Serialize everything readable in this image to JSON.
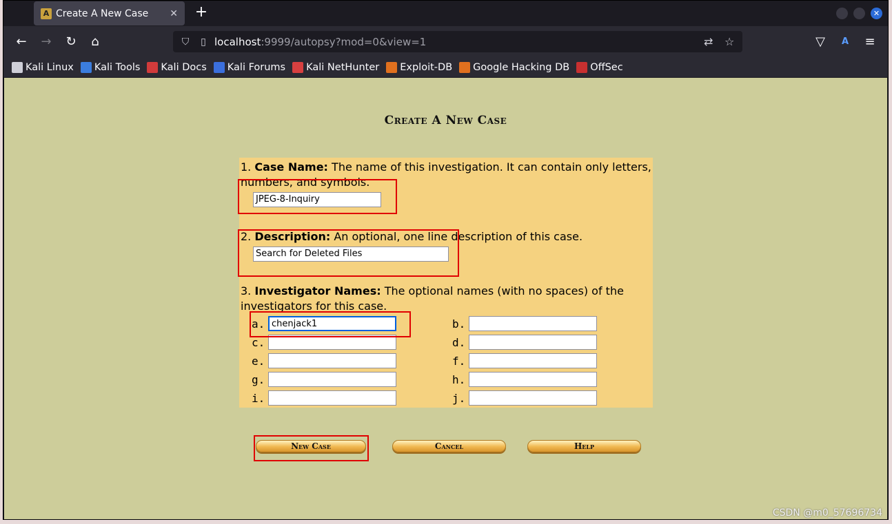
{
  "browser": {
    "tab_title": "Create A New Case",
    "tab_close": "✕",
    "new_tab": "+",
    "url_host": "localhost",
    "url_path": ":9999/autopsy?mod=0&view=1",
    "bookmarks": [
      {
        "label": "Kali Linux",
        "icon": "kali-dragon-icon",
        "color": "#cfcfd8"
      },
      {
        "label": "Kali Tools",
        "icon": "kali-tools-icon",
        "color": "#3b7ddd"
      },
      {
        "label": "Kali Docs",
        "icon": "kali-docs-icon",
        "color": "#d13b3b"
      },
      {
        "label": "Kali Forums",
        "icon": "kali-forums-icon",
        "color": "#3b6fdd"
      },
      {
        "label": "Kali NetHunter",
        "icon": "kali-nethunter-icon",
        "color": "#d84040"
      },
      {
        "label": "Exploit-DB",
        "icon": "exploit-db-icon",
        "color": "#e0701e"
      },
      {
        "label": "Google Hacking DB",
        "icon": "ghdb-icon",
        "color": "#e0701e"
      },
      {
        "label": "OffSec",
        "icon": "offsec-icon",
        "color": "#c83030"
      }
    ]
  },
  "page": {
    "title": "Create A New Case",
    "case_name": {
      "number": "1.",
      "label": "Case Name:",
      "help": " The name of this investigation. It can contain only letters, numbers, and symbols.",
      "value": "JPEG-8-Inquiry"
    },
    "description": {
      "number": "2.",
      "label": "Description:",
      "help": " An optional, one line description of this case.",
      "value": "Search for Deleted Files"
    },
    "investigators": {
      "number": "3.",
      "label": "Investigator Names:",
      "help": " The optional names (with no spaces) of the investigators for this case.",
      "fields": [
        {
          "letter": "a.",
          "value": "chenjack1"
        },
        {
          "letter": "b.",
          "value": ""
        },
        {
          "letter": "c.",
          "value": ""
        },
        {
          "letter": "d.",
          "value": ""
        },
        {
          "letter": "e.",
          "value": ""
        },
        {
          "letter": "f.",
          "value": ""
        },
        {
          "letter": "g.",
          "value": ""
        },
        {
          "letter": "h.",
          "value": ""
        },
        {
          "letter": "i.",
          "value": ""
        },
        {
          "letter": "j.",
          "value": ""
        }
      ]
    },
    "buttons": {
      "new_case": "New Case",
      "cancel": "Cancel",
      "help": "Help"
    }
  },
  "watermark": "CSDN @m0_57696734",
  "colors": {
    "page_bg": "#cdcd9a",
    "form_bg": "#f5d280",
    "highlight": "#e00000"
  }
}
